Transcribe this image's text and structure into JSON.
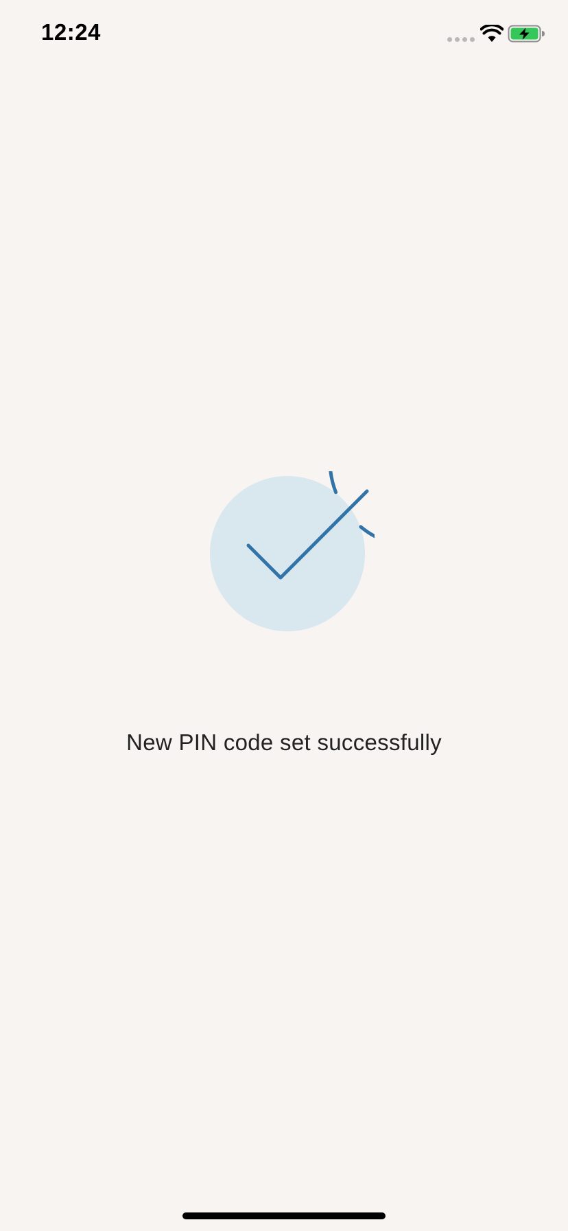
{
  "status_bar": {
    "time": "12:24",
    "icons": [
      "cellular-signal-icon",
      "wifi-icon",
      "battery-charging-icon"
    ]
  },
  "success": {
    "icon": "checkmark-circle-icon",
    "message": "New PIN code set successfully"
  },
  "colors": {
    "background": "#f7f4f2",
    "accent": "#3274a8",
    "accent_light": "#d9e7ee",
    "battery_fill": "#35c759"
  }
}
